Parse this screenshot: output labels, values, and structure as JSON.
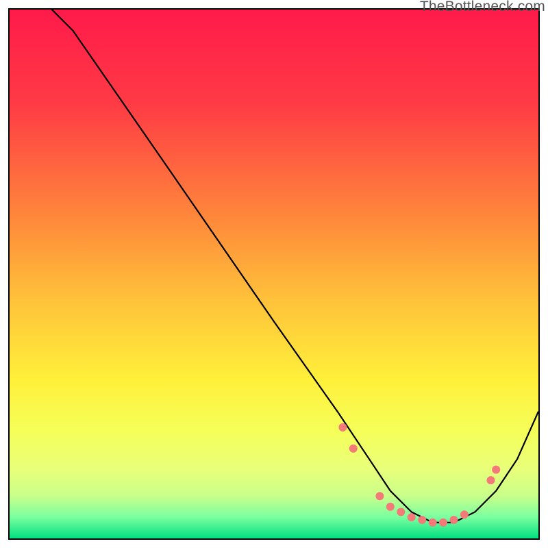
{
  "watermark": "TheBottleneck.com",
  "chart_data": {
    "type": "line",
    "title": "",
    "xlabel": "",
    "ylabel": "",
    "xlim": [
      0,
      100
    ],
    "ylim": [
      0,
      100
    ],
    "gradient_stops": [
      {
        "offset": 0,
        "color": "#ff1a4a"
      },
      {
        "offset": 18,
        "color": "#ff3b45"
      },
      {
        "offset": 40,
        "color": "#ff8a3a"
      },
      {
        "offset": 55,
        "color": "#ffc23a"
      },
      {
        "offset": 70,
        "color": "#fff03a"
      },
      {
        "offset": 80,
        "color": "#f5ff5a"
      },
      {
        "offset": 87,
        "color": "#e8ff7a"
      },
      {
        "offset": 92,
        "color": "#c8ff8a"
      },
      {
        "offset": 96,
        "color": "#7affa0"
      },
      {
        "offset": 100,
        "color": "#00e080"
      }
    ],
    "series": [
      {
        "name": "bottleneck-curve",
        "x": [
          0,
          4,
          8,
          12,
          30,
          50,
          62,
          68,
          72,
          76,
          80,
          84,
          88,
          92,
          96,
          100
        ],
        "y": [
          110,
          105,
          100,
          96,
          70,
          41,
          24,
          15,
          9,
          5,
          3,
          3,
          5,
          9,
          15,
          24
        ]
      }
    ],
    "markers": {
      "name": "curve-dots",
      "color": "#f47a7a",
      "radius": 6,
      "points": [
        {
          "x": 63,
          "y": 21
        },
        {
          "x": 65,
          "y": 17
        },
        {
          "x": 70,
          "y": 8
        },
        {
          "x": 72,
          "y": 6
        },
        {
          "x": 74,
          "y": 5
        },
        {
          "x": 76,
          "y": 4
        },
        {
          "x": 78,
          "y": 3.5
        },
        {
          "x": 80,
          "y": 3
        },
        {
          "x": 82,
          "y": 3
        },
        {
          "x": 84,
          "y": 3.5
        },
        {
          "x": 86,
          "y": 4.5
        },
        {
          "x": 91,
          "y": 11
        },
        {
          "x": 92,
          "y": 13
        }
      ]
    }
  }
}
